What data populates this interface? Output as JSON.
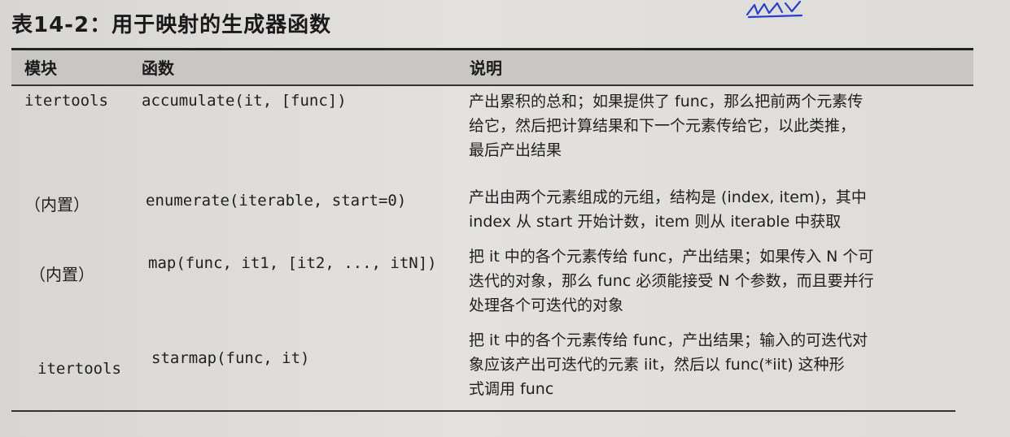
{
  "table": {
    "title": "表14-2：用于映射的生成器函数",
    "headers": {
      "module": "模块",
      "function": "函数",
      "description": "说明"
    },
    "rows": [
      {
        "module": "itertools",
        "function": "accumulate(it, [func])",
        "desc": [
          "产出累积的总和；如果提供了 func，那么把前两个元素传",
          "给它，然后把计算结果和下一个元素传给它，以此类推，",
          "最后产出结果"
        ]
      },
      {
        "module": "（内置）",
        "function": "enumerate(iterable, start=0)",
        "desc": [
          "产出由两个元素组成的元组，结构是 (index, item)，其中",
          "index 从 start 开始计数，item 则从 iterable 中获取"
        ]
      },
      {
        "module": "（内置）",
        "function": "map(func, it1, [it2, ..., itN])",
        "desc": [
          "把 it 中的各个元素传给 func，产出结果；如果传入 N 个可",
          "迭代的对象，那么 func 必须能接受 N 个参数，而且要并行",
          "处理各个可迭代的对象"
        ]
      },
      {
        "module": "itertools",
        "function": "starmap(func, it)",
        "desc": [
          "把 it 中的各个元素传给 func，产出结果；输入的可迭代对",
          "象应该产出可迭代的元素 iit，然后以 func(*iit) 这种形",
          "式调用 func"
        ]
      }
    ]
  },
  "colors": {
    "ink": "#1c1c1c",
    "paper": "#dcdad7",
    "header_band": "#c9c7c4",
    "scribble": "#2a3fc9"
  }
}
